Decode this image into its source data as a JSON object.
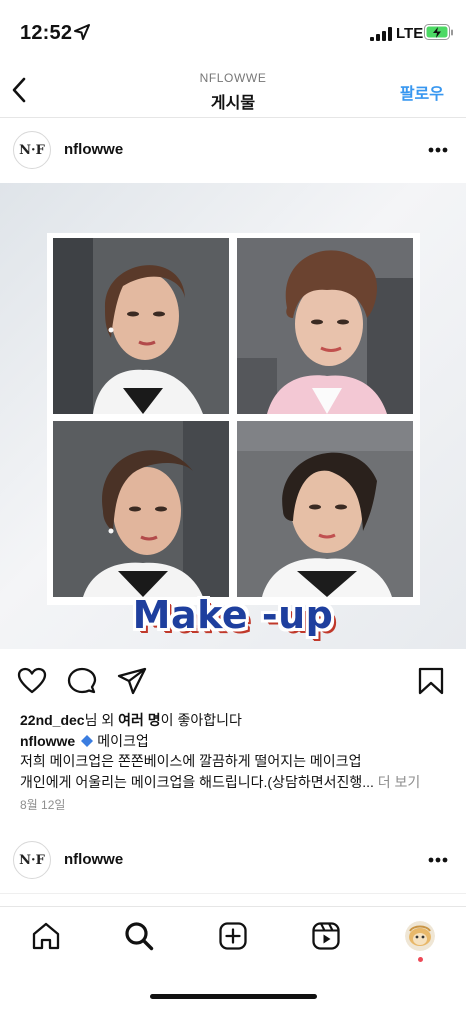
{
  "status_bar": {
    "time": "12:52",
    "network": "LTE",
    "icons": [
      "location-arrow-icon",
      "signal-icon",
      "battery-charging-icon"
    ]
  },
  "header": {
    "subtitle": "NFLOWWE",
    "title": "게시물",
    "follow_label": "팔로우",
    "back_icon": "chevron-left-icon",
    "accent_color": "#3897f0"
  },
  "post": {
    "username": "nflowwe",
    "avatar_text": "N·F",
    "image_caption_overlay": "Make -up",
    "likes": {
      "user": "22nd_dec",
      "mid": "님 외 ",
      "bold_count": "여러 명",
      "suffix": "이 좋아합니다"
    },
    "caption": {
      "user": "nflowwe",
      "title": "메이크업",
      "line1": "저희 메이크업은 쫀쫀베이스에 깔끔하게 떨어지는 메이크업",
      "line2": "개인에게 어울리는 메이크업을 해드립니다.(상담하면서진행... ",
      "more_label": "더 보기"
    },
    "date": "8월 12일",
    "actions": [
      "heart-icon",
      "comment-icon",
      "share-icon",
      "bookmark-icon"
    ]
  },
  "next_post": {
    "username": "nflowwe",
    "avatar_text": "N·F"
  },
  "tab_bar": {
    "items": [
      "home-icon",
      "search-icon",
      "create-icon",
      "reels-icon",
      "profile-avatar"
    ],
    "notification_color": "#ed4956"
  }
}
